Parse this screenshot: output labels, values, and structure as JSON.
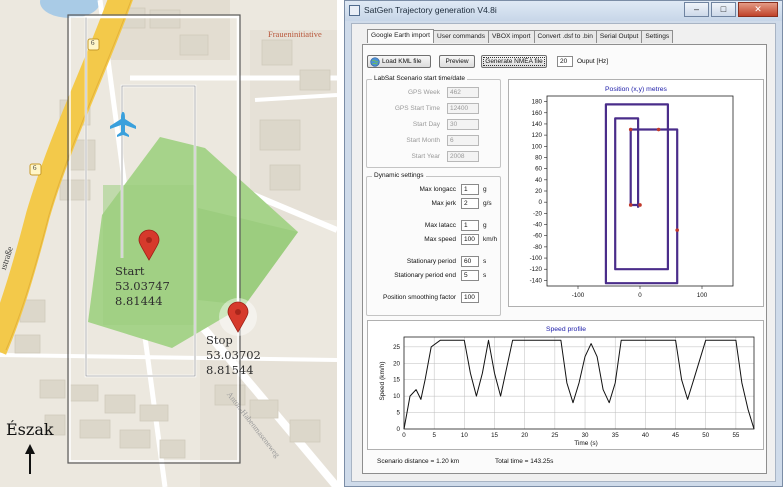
{
  "map": {
    "street_left": "ıstraße",
    "street_bottom": "Anton-Habenmaseneweg",
    "poi_label": "Fraueninitiative",
    "road_shield_1": "6",
    "road_shield_2": "6",
    "start_label": "Start",
    "start_lat": "53.03747",
    "start_lon": "8.81444",
    "stop_label": "Stop",
    "stop_lat": "53.03702",
    "stop_lon": "8.81544",
    "north_label": "Észak",
    "colors": {
      "park": "#a6d38a",
      "road_yellow": "#f3c94a",
      "track": "#ffffff",
      "pin": "#d63a2c",
      "plane": "#3aa0dc"
    }
  },
  "window": {
    "title": "SatGen Trajectory generation V4.8i",
    "minimize": "–",
    "maximize": "□",
    "close": "✕"
  },
  "tabs": [
    {
      "label": "Google Earth import",
      "active": true
    },
    {
      "label": "User commands",
      "active": false
    },
    {
      "label": "VBOX import",
      "active": false
    },
    {
      "label": "Convert .dsf to .bin",
      "active": false
    },
    {
      "label": "Serial Output",
      "active": false
    },
    {
      "label": "Settings",
      "active": false
    }
  ],
  "toolbar": {
    "load_kml": "Load KML file",
    "preview": "Preview",
    "generate_nmea": "Generate NMEA file",
    "output_hz_value": "20",
    "output_hz_label": "Ouput [Hz]"
  },
  "scenario_group": {
    "title": "LabSat Scenario start time/date",
    "fields": [
      {
        "label": "GPS Week",
        "value": "462"
      },
      {
        "label": "GPS Start Time",
        "value": "12400"
      },
      {
        "label": "Start Day",
        "value": "30"
      },
      {
        "label": "Start Month",
        "value": "6"
      },
      {
        "label": "Start Year",
        "value": "2008"
      }
    ]
  },
  "dynamic_group": {
    "title": "Dynamic settings",
    "rows": [
      {
        "label": "Max longacc",
        "value": "1",
        "unit": "g"
      },
      {
        "label": "Max jerk",
        "value": "2",
        "unit": "g/s"
      },
      {
        "label": "Max latacc",
        "value": "1",
        "unit": "g"
      },
      {
        "label": "Max speed",
        "value": "100",
        "unit": "km/h"
      },
      {
        "label": "Stationary period",
        "value": "60",
        "unit": "s"
      },
      {
        "label": "Stationary period end",
        "value": "5",
        "unit": "s"
      },
      {
        "label": "Position smoothing factor",
        "value": "100",
        "unit": ""
      }
    ]
  },
  "status": {
    "distance": "Scenario distance = 1.20 km",
    "total_time": "Total time = 143.25s"
  },
  "chart_data": [
    {
      "type": "line",
      "title": "Position (x,y) metres",
      "xlabel": "",
      "ylabel": "",
      "xlim": [
        -150,
        150
      ],
      "ylim": [
        -150,
        190
      ],
      "xticks": [
        -100,
        0,
        100
      ],
      "yticks": [
        -140,
        -120,
        -100,
        -80,
        -60,
        -40,
        -20,
        0,
        20,
        40,
        60,
        80,
        100,
        120,
        140,
        160,
        180
      ],
      "grid": false,
      "series": [
        {
          "color": "#4a2d8a",
          "x": [
            -3,
            -3,
            -40,
            -40,
            45,
            45,
            -55,
            -55,
            60,
            60,
            -15,
            -15,
            0
          ],
          "y": [
            -10,
            150,
            150,
            -120,
            -120,
            175,
            175,
            -145,
            -145,
            130,
            130,
            -5,
            -5
          ]
        }
      ],
      "points": [
        {
          "x": -15,
          "y": 130
        },
        {
          "x": 30,
          "y": 130
        },
        {
          "x": -15,
          "y": -5
        },
        {
          "x": 0,
          "y": -5
        },
        {
          "x": 60,
          "y": -50
        }
      ]
    },
    {
      "type": "line",
      "title": "Speed profile",
      "xlabel": "Time (s)",
      "ylabel": "Speed (km/h)",
      "xlim": [
        0,
        58
      ],
      "ylim": [
        0,
        28
      ],
      "xticks": [
        0,
        5,
        10,
        15,
        20,
        25,
        30,
        35,
        40,
        45,
        50,
        55
      ],
      "yticks": [
        0,
        5,
        10,
        15,
        20,
        25
      ],
      "grid": true,
      "series": [
        {
          "color": "#111111",
          "x": [
            0,
            1,
            2,
            2.8,
            3.5,
            4.5,
            6,
            8,
            10,
            11,
            12,
            13,
            14,
            15,
            16,
            18,
            20,
            24,
            26,
            27,
            28,
            29,
            30,
            31,
            32,
            33,
            34,
            35,
            36,
            37,
            42,
            45,
            46,
            47,
            48,
            50,
            52,
            55,
            56,
            57,
            58
          ],
          "y": [
            0,
            10,
            12,
            9,
            15,
            25,
            27,
            27,
            27,
            17,
            10,
            17,
            27,
            17,
            10,
            27,
            27,
            27,
            27,
            14,
            8,
            14,
            22,
            26,
            22,
            12,
            8,
            14,
            27,
            27,
            27,
            27,
            15,
            9,
            15,
            27,
            27,
            27,
            14,
            6,
            0
          ]
        }
      ]
    }
  ]
}
